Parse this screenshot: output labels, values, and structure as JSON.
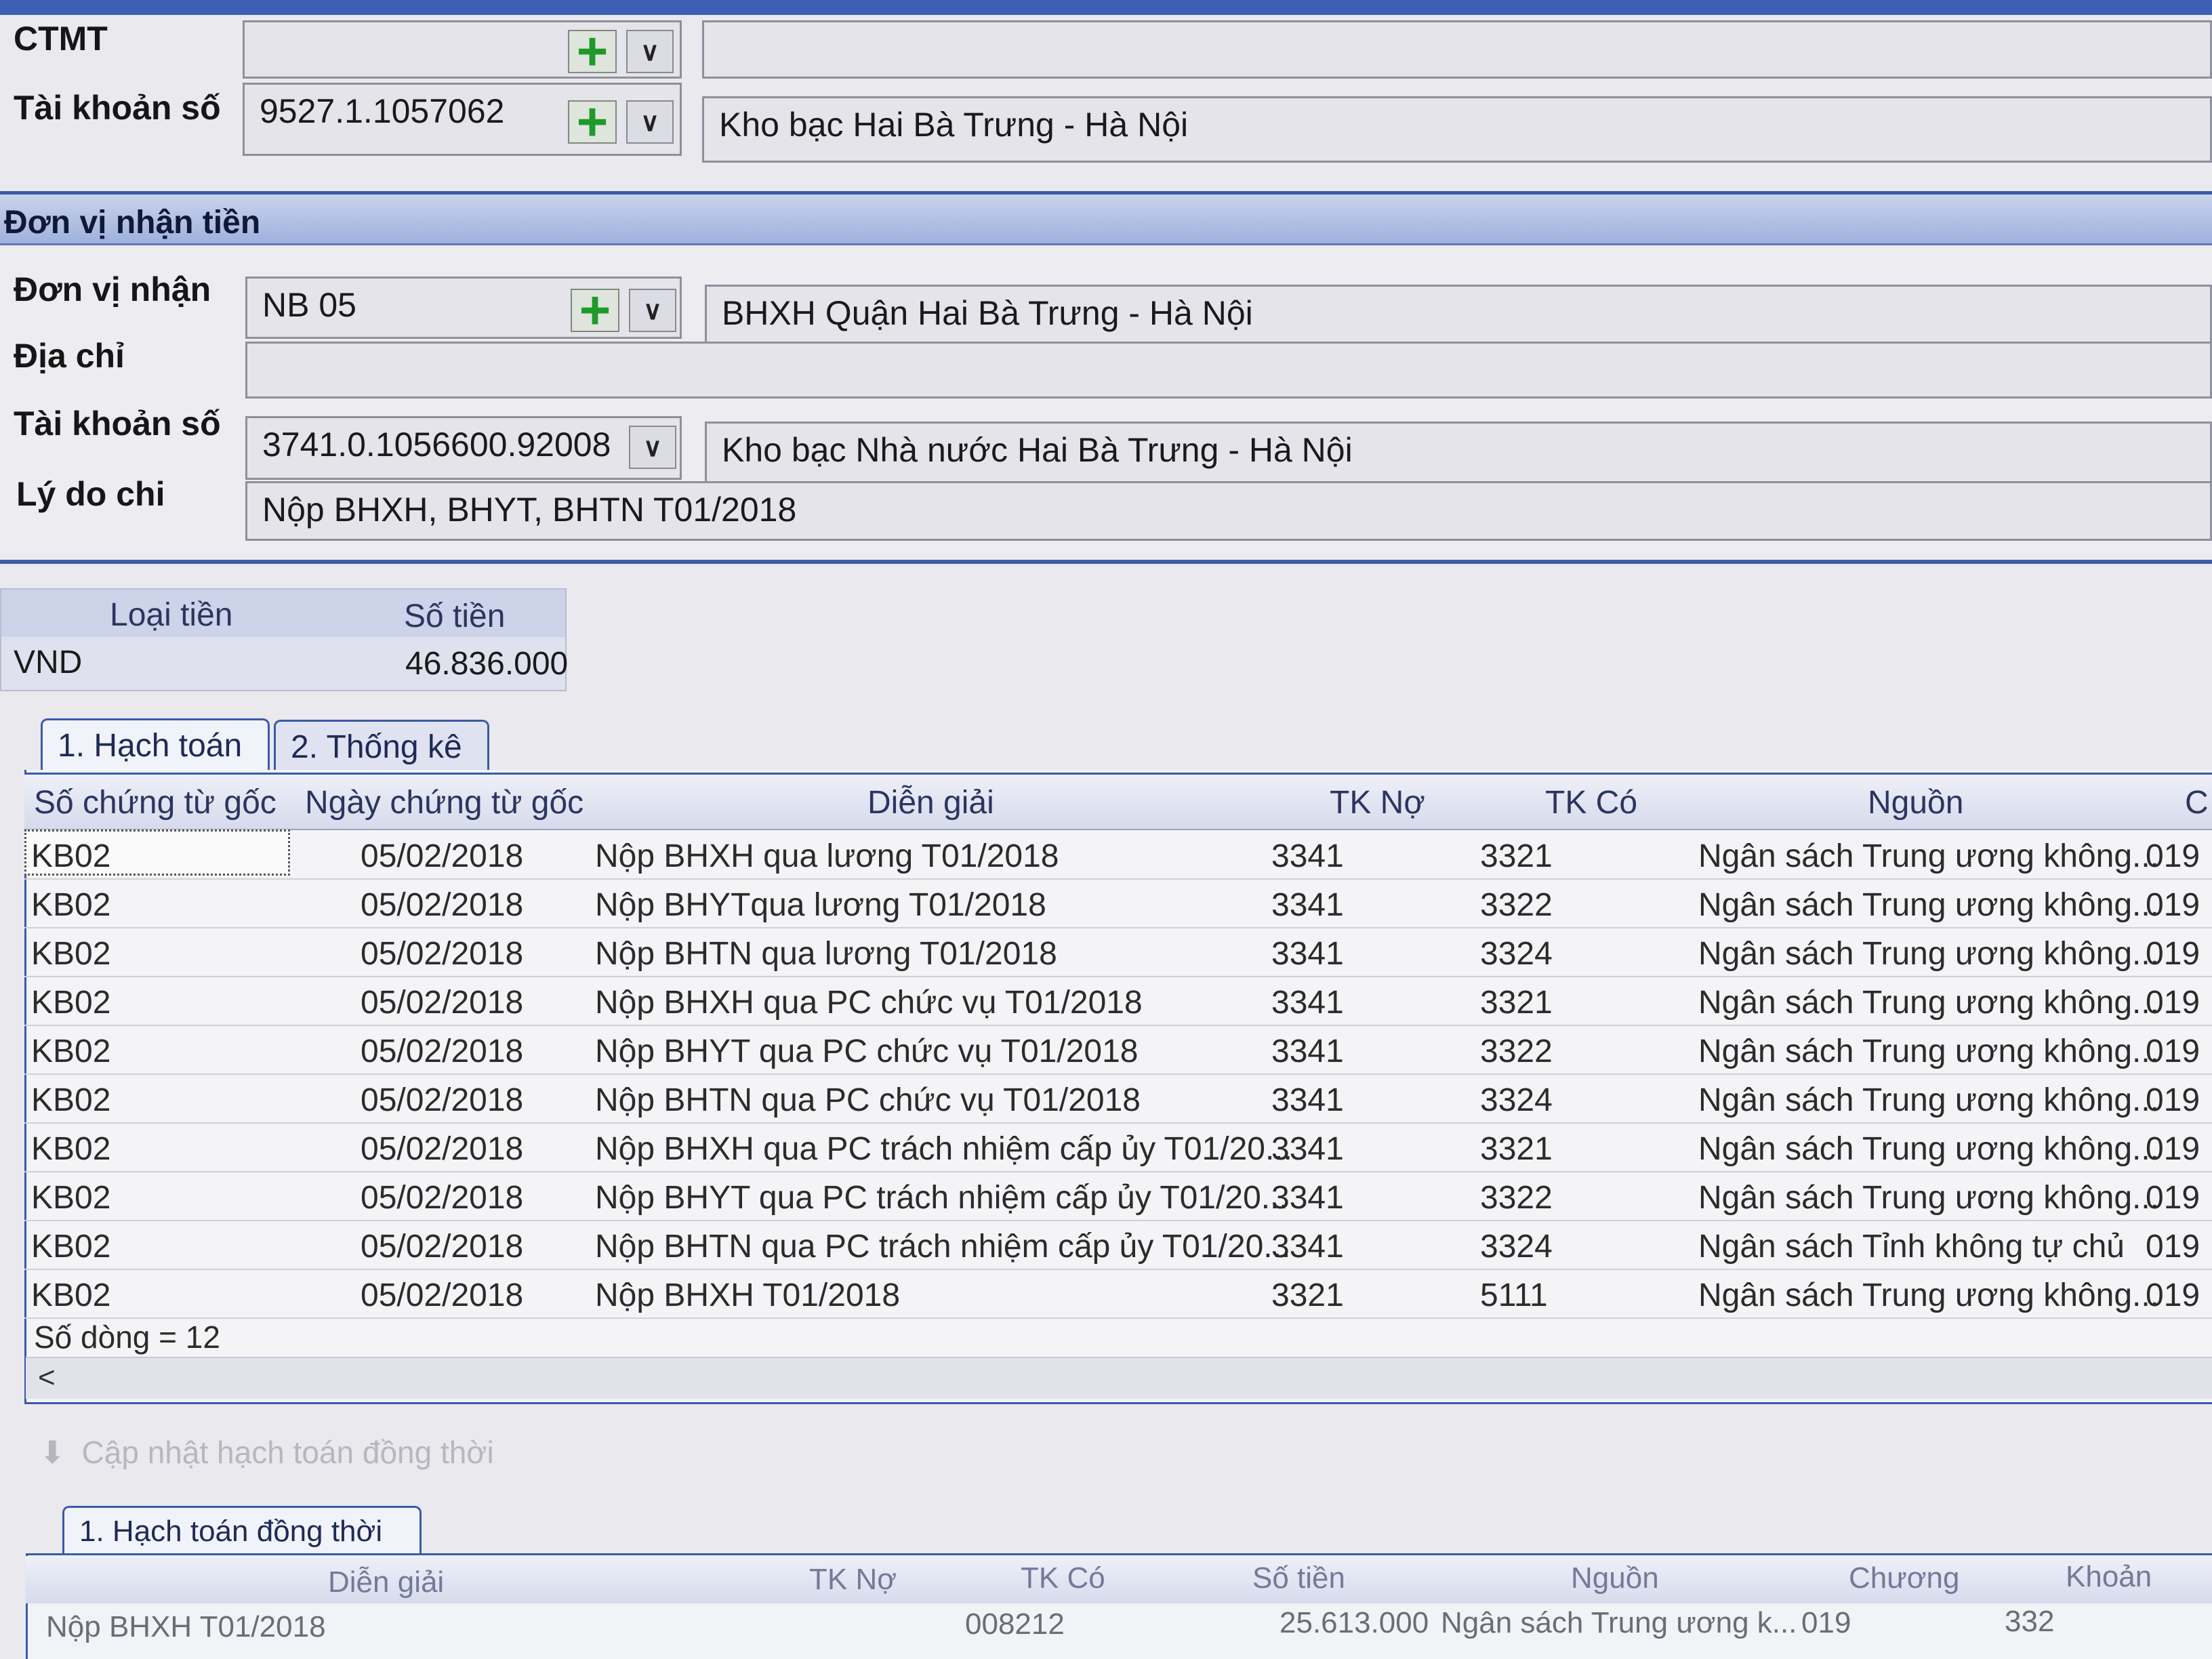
{
  "header": {
    "ctmt_label": "CTMT",
    "ctmt_value": "",
    "account_label": "Tài khoản số",
    "account_value": "9527.1.1057062",
    "account_bank": "Kho bạc Hai Bà Trưng - Hà Nội"
  },
  "recipient": {
    "section_title": "Đơn vị nhận tiền",
    "unit_label": "Đơn vị nhận",
    "unit_code": "NB 05",
    "unit_name": "BHXH Quận Hai Bà Trưng - Hà Nội",
    "address_label": "Địa chỉ",
    "address_value": "",
    "account_label": "Tài khoản số",
    "account_value": "3741.0.1056600.92008",
    "account_bank": "Kho bạc Nhà nước Hai Bà Trưng - Hà Nội",
    "reason_label": "Lý do chi",
    "reason_value": "Nộp BHXH, BHYT, BHTN T01/2018"
  },
  "currency": {
    "col_type": "Loại tiền",
    "col_amount": "Số tiền",
    "type": "VND",
    "amount": "46.836.000"
  },
  "tabs": [
    {
      "label": "1. Hạch toán"
    },
    {
      "label": "2. Thống kê"
    }
  ],
  "grid": {
    "columns": [
      "Số chứng từ gốc",
      "Ngày chứng từ gốc",
      "Diễn giải",
      "TK Nợ",
      "TK Có",
      "Nguồn",
      "C"
    ],
    "rows": [
      [
        "KB02",
        "05/02/2018",
        "Nộp BHXH qua lương T01/2018",
        "3341",
        "3321",
        "Ngân sách Trung ương không...",
        "019"
      ],
      [
        "KB02",
        "05/02/2018",
        "Nộp BHYTqua lương T01/2018",
        "3341",
        "3322",
        "Ngân sách Trung ương không...",
        "019"
      ],
      [
        "KB02",
        "05/02/2018",
        "Nộp BHTN qua lương T01/2018",
        "3341",
        "3324",
        "Ngân sách Trung ương không...",
        "019"
      ],
      [
        "KB02",
        "05/02/2018",
        "Nộp BHXH qua PC chức vụ T01/2018",
        "3341",
        "3321",
        "Ngân sách Trung ương không...",
        "019"
      ],
      [
        "KB02",
        "05/02/2018",
        "Nộp BHYT qua PC chức vụ T01/2018",
        "3341",
        "3322",
        "Ngân sách Trung ương không...",
        "019"
      ],
      [
        "KB02",
        "05/02/2018",
        "Nộp BHTN qua PC chức vụ T01/2018",
        "3341",
        "3324",
        "Ngân sách Trung ương không...",
        "019"
      ],
      [
        "KB02",
        "05/02/2018",
        "Nộp BHXH qua PC trách nhiệm cấp ủy T01/20...",
        "3341",
        "3321",
        "Ngân sách Trung ương không...",
        "019"
      ],
      [
        "KB02",
        "05/02/2018",
        "Nộp BHYT qua PC trách nhiệm cấp ủy T01/20...",
        "3341",
        "3322",
        "Ngân sách Trung ương không...",
        "019"
      ],
      [
        "KB02",
        "05/02/2018",
        "Nộp BHTN qua PC trách nhiệm cấp ủy T01/20...",
        "3341",
        "3324",
        "Ngân sách Tỉnh không tự chủ",
        "019"
      ],
      [
        "KB02",
        "05/02/2018",
        "Nộp BHXH T01/2018",
        "3321",
        "5111",
        "Ngân sách Trung ương không...",
        "019"
      ]
    ],
    "row_count": "Số dòng = 12",
    "scroll_left": "<"
  },
  "update_button": "Cập nhật hạch toán đồng thời",
  "sub_tabs": [
    {
      "label": "1. Hạch toán đồng thời"
    }
  ],
  "sub_grid": {
    "columns": [
      "Diễn giải",
      "TK Nợ",
      "TK Có",
      "Số tiền",
      "Nguồn",
      "Chương",
      "Khoản"
    ],
    "rows": [
      [
        "Nộp BHXH T01/2018",
        "",
        "008212",
        "25.613.000",
        "Ngân sách Trung ương k...",
        "019",
        "332"
      ]
    ]
  },
  "colors": {
    "accent": "#3b5aa8",
    "section_bg": "#a8b8e0",
    "plus_icon": "#1f9a2a"
  }
}
